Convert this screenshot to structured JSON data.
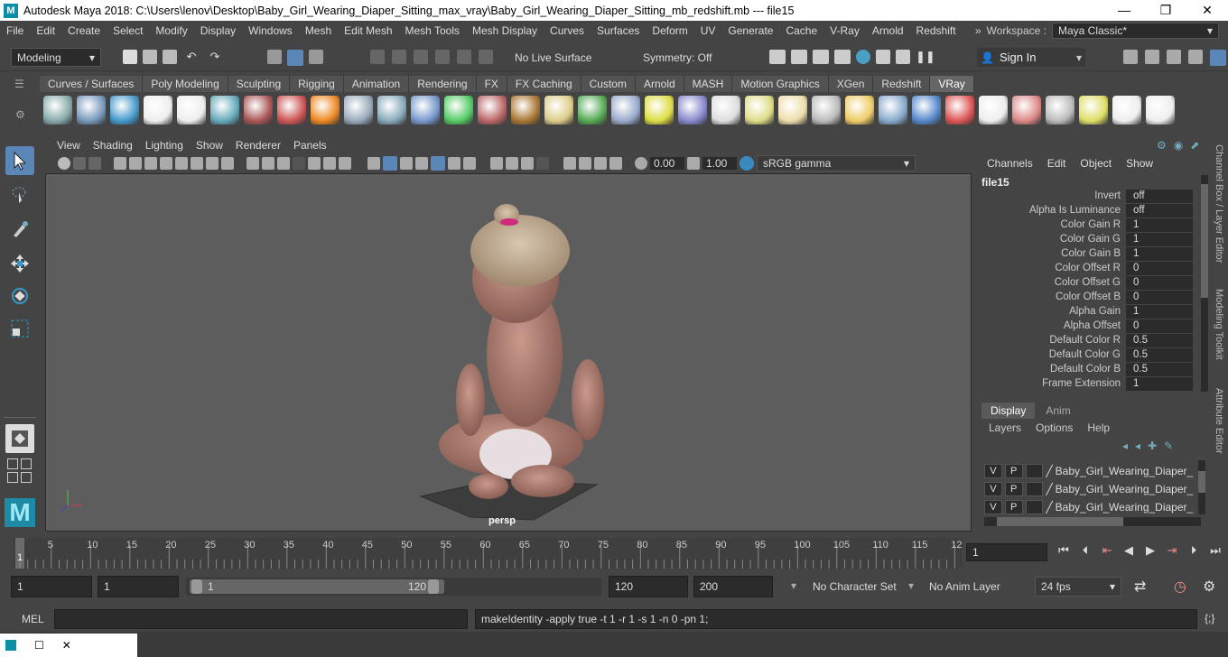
{
  "window": {
    "title": "Autodesk Maya 2018: C:\\Users\\lenov\\Desktop\\Baby_Girl_Wearing_Diaper_Sitting_max_vray\\Baby_Girl_Wearing_Diaper_Sitting_mb_redshift.mb   ---   file15",
    "controls": [
      "—",
      "❐",
      "✕"
    ]
  },
  "menubar": {
    "items": [
      "File",
      "Edit",
      "Create",
      "Select",
      "Modify",
      "Display",
      "Windows",
      "Mesh",
      "Edit Mesh",
      "Mesh Tools",
      "Mesh Display",
      "Curves",
      "Surfaces",
      "Deform",
      "UV",
      "Generate",
      "Cache",
      "V-Ray",
      "Arnold",
      "Redshift"
    ],
    "overflow": "»",
    "workspace_label": "Workspace :",
    "workspace_value": "Maya Classic*"
  },
  "statusline": {
    "mode": "Modeling",
    "live_surface": "No Live Surface",
    "symmetry": "Symmetry: Off",
    "sign_in": "Sign In"
  },
  "shelf": {
    "tabs": [
      "Curves / Surfaces",
      "Poly Modeling",
      "Sculpting",
      "Rigging",
      "Animation",
      "Rendering",
      "FX",
      "FX Caching",
      "Custom",
      "Arnold",
      "MASH",
      "Motion Graphics",
      "XGen",
      "Redshift",
      "VRay"
    ],
    "active_tab": "VRay",
    "icon_colors": [
      "#8aa",
      "#79b",
      "#49c",
      "#eee",
      "#eee",
      "#6ab",
      "#a55",
      "#c55",
      "#e82",
      "#9ab",
      "#8ab",
      "#79c",
      "#5c6",
      "#b66",
      "#a73",
      "#dc8",
      "#5a5",
      "#9ac",
      "#dd4",
      "#88c",
      "#ddd",
      "#dd8",
      "#eda",
      "#bbb",
      "#ec6",
      "#8ac",
      "#58c",
      "#d55",
      "#eee",
      "#d88",
      "#bbb",
      "#dd6",
      "#eee",
      "#eee"
    ]
  },
  "viewport": {
    "menus": [
      "View",
      "Shading",
      "Lighting",
      "Show",
      "Renderer",
      "Panels"
    ],
    "exposure": "0.00",
    "gamma": "1.00",
    "colorspace": "sRGB gamma",
    "camera": "persp"
  },
  "channelbox": {
    "menus": [
      "Channels",
      "Edit",
      "Object",
      "Show"
    ],
    "node": "file15",
    "rows": [
      {
        "label": "Invert",
        "value": "off"
      },
      {
        "label": "Alpha Is Luminance",
        "value": "off"
      },
      {
        "label": "Color Gain R",
        "value": "1"
      },
      {
        "label": "Color Gain G",
        "value": "1"
      },
      {
        "label": "Color Gain B",
        "value": "1"
      },
      {
        "label": "Color Offset R",
        "value": "0"
      },
      {
        "label": "Color Offset G",
        "value": "0"
      },
      {
        "label": "Color Offset B",
        "value": "0"
      },
      {
        "label": "Alpha Gain",
        "value": "1"
      },
      {
        "label": "Alpha Offset",
        "value": "0"
      },
      {
        "label": "Default Color R",
        "value": "0.5"
      },
      {
        "label": "Default Color G",
        "value": "0.5"
      },
      {
        "label": "Default Color B",
        "value": "0.5"
      },
      {
        "label": "Frame Extension",
        "value": "1"
      }
    ]
  },
  "layereditor": {
    "tabs": [
      "Display",
      "Anim"
    ],
    "menus": [
      "Layers",
      "Options",
      "Help"
    ],
    "layers": [
      {
        "v": "V",
        "p": "P",
        "name": "Baby_Girl_Wearing_Diaper_S"
      },
      {
        "v": "V",
        "p": "P",
        "name": "Baby_Girl_Wearing_Diaper_S"
      },
      {
        "v": "V",
        "p": "P",
        "name": "Baby_Girl_Wearing_Diaper_S"
      }
    ]
  },
  "sidetabs": [
    "Channel Box / Layer Editor",
    "Modeling Toolkit",
    "Attribute Editor"
  ],
  "timeline": {
    "ticks": [
      "5",
      "10",
      "15",
      "20",
      "25",
      "30",
      "35",
      "40",
      "45",
      "50",
      "55",
      "60",
      "65",
      "70",
      "75",
      "80",
      "85",
      "90",
      "95",
      "100",
      "105",
      "110",
      "115",
      "12"
    ],
    "start_marker": "1",
    "current_frame": "1"
  },
  "range": {
    "start": "1",
    "playback_start": "1",
    "slider_start": "1",
    "slider_end": "120",
    "playback_end": "120",
    "end": "200",
    "character_set": "No Character Set",
    "anim_layer": "No Anim Layer",
    "fps": "24 fps"
  },
  "command": {
    "lang": "MEL",
    "feedback": "makeIdentity -apply true -t 1 -r 1 -s 1 -n 0 -pn 1;"
  }
}
